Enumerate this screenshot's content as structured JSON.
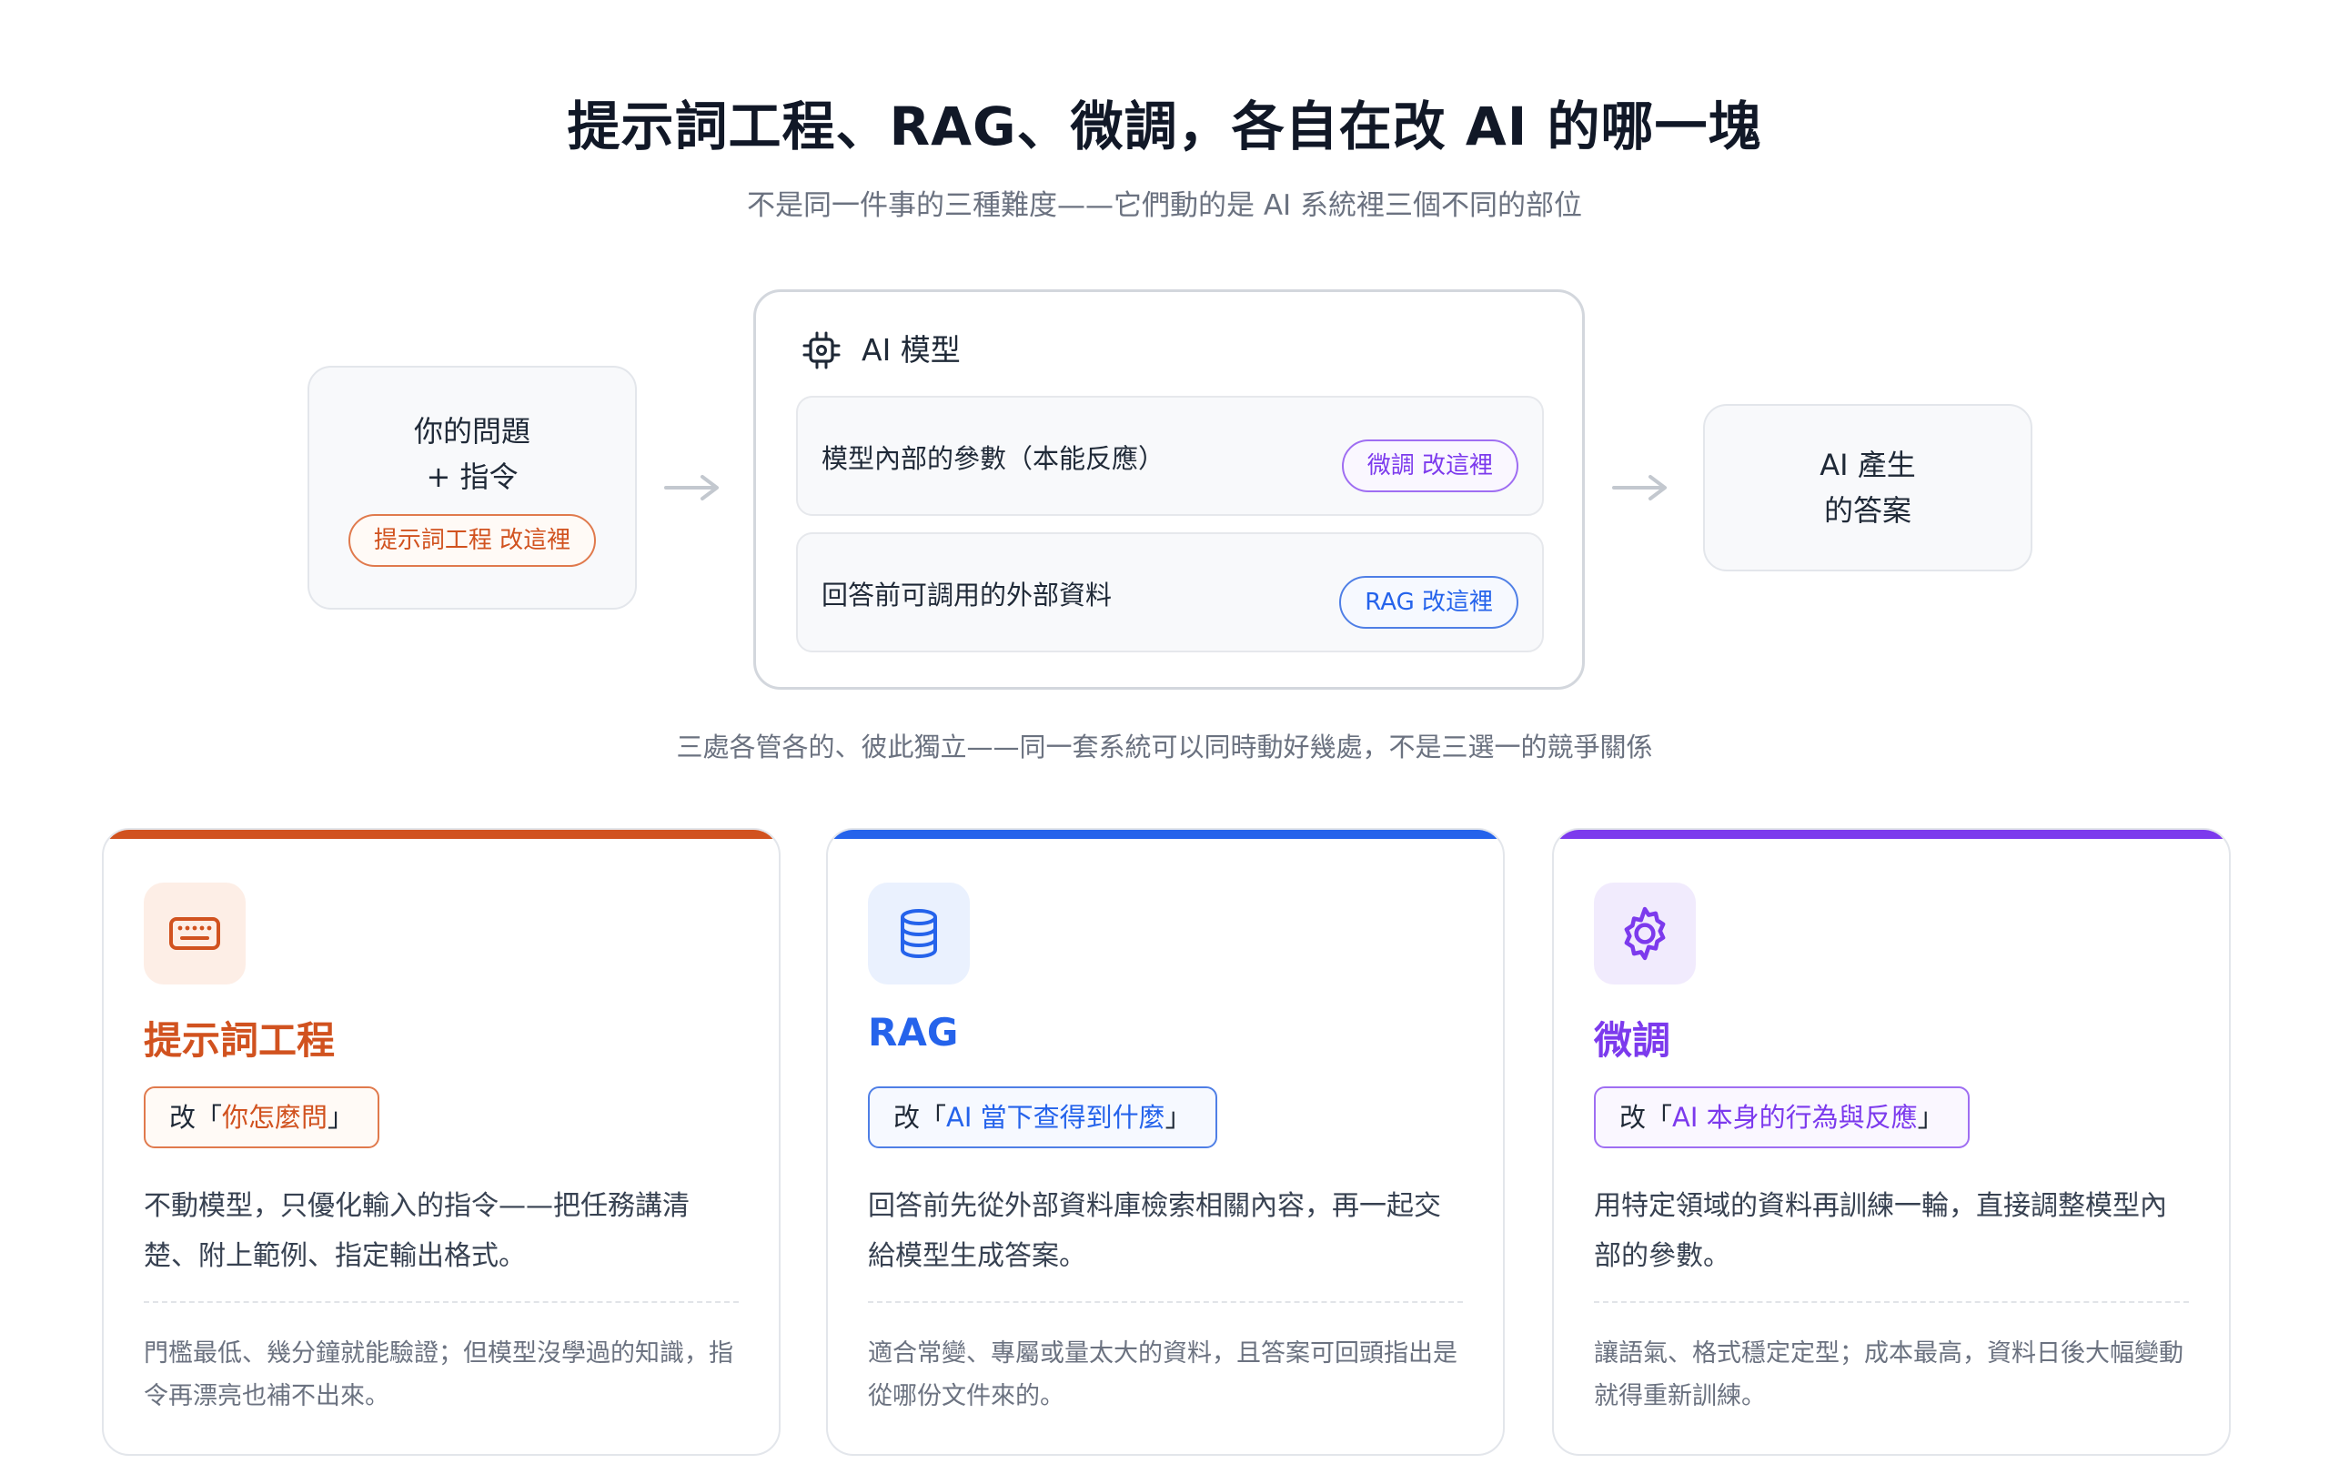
{
  "title": "提示詞工程、RAG、微調，各自在改 AI 的哪一塊",
  "subtitle": "不是同一件事的三種難度——它們動的是 AI 系統裡三個不同的部位",
  "diagram": {
    "input_box": {
      "line1": "你的問題",
      "line2": "+ 指令",
      "pill": "提示詞工程 改這裡"
    },
    "model_box": {
      "icon": "cpu-chip-icon",
      "title": "AI 模型",
      "rows": [
        {
          "label": "模型內部的參數（本能反應）",
          "pill": "微調 改這裡"
        },
        {
          "label": "回答前可調用的外部資料",
          "pill": "RAG 改這裡"
        }
      ]
    },
    "output_box": {
      "line1": "AI 產生",
      "line2": "的答案"
    }
  },
  "note": "三處各管各的、彼此獨立——同一套系統可以同時動好幾處，不是三選一的競爭關係",
  "colors": {
    "orange": "#d1521f",
    "blue": "#2563eb",
    "purple": "#7c3aed"
  },
  "cards": [
    {
      "icon": "keyboard-icon",
      "title": "提示詞工程",
      "tag_prefix": "改「",
      "tag_value": "你怎麼問",
      "tag_suffix": "」",
      "desc": "不動模型，只優化輸入的指令——把任務講清楚、附上範例、指定輸出格式。",
      "foot": "門檻最低、幾分鐘就能驗證；但模型沒學過的知識，指令再漂亮也補不出來。"
    },
    {
      "icon": "database-icon",
      "title": "RAG",
      "tag_prefix": "改「",
      "tag_value": "AI 當下查得到什麼",
      "tag_suffix": "」",
      "desc": "回答前先從外部資料庫檢索相關內容，再一起交給模型生成答案。",
      "foot": "適合常變、專屬或量太大的資料，且答案可回頭指出是從哪份文件來的。"
    },
    {
      "icon": "gear-icon",
      "title": "微調",
      "tag_prefix": "改「",
      "tag_value": "AI 本身的行為與反應",
      "tag_suffix": "」",
      "desc": "用特定領域的資料再訓練一輪，直接調整模型內部的參數。",
      "foot": "讓語氣、格式穩定定型；成本最高，資料日後大幅變動就得重新訓練。"
    }
  ]
}
